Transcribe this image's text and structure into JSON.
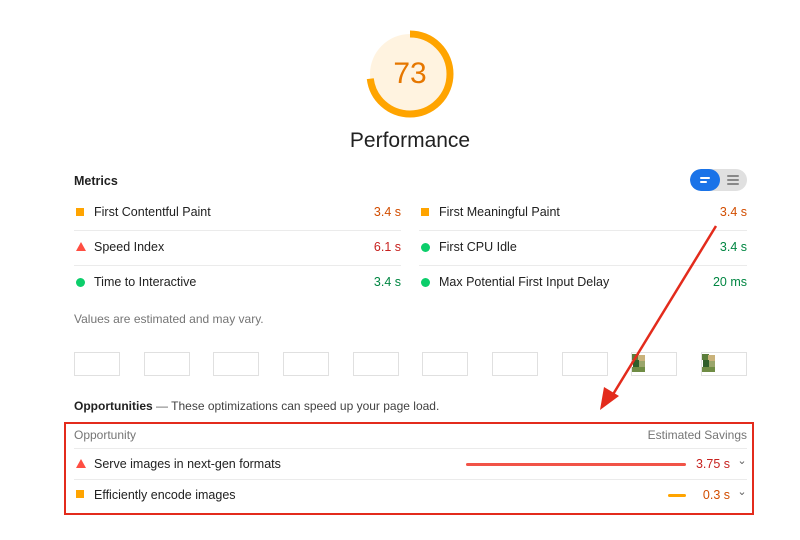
{
  "score": {
    "value": "73",
    "fraction": 0.73,
    "color": "#ffa400"
  },
  "category_title": "Performance",
  "metrics": {
    "title": "Metrics",
    "toggle": {
      "selected": "list-view",
      "options": [
        "list-view",
        "text-view"
      ]
    },
    "items": [
      {
        "label": "First Contentful Paint",
        "value": "3.4 s",
        "status": "average"
      },
      {
        "label": "First Meaningful Paint",
        "value": "3.4 s",
        "status": "average"
      },
      {
        "label": "Speed Index",
        "value": "6.1 s",
        "status": "fail"
      },
      {
        "label": "First CPU Idle",
        "value": "3.4 s",
        "status": "pass"
      },
      {
        "label": "Time to Interactive",
        "value": "3.4 s",
        "status": "pass"
      },
      {
        "label": "Max Potential First Input Delay",
        "value": "20 ms",
        "status": "pass"
      }
    ],
    "note": "Values are estimated and may vary."
  },
  "filmstrip": {
    "frames": 10,
    "frames_with_image": [
      9,
      10
    ]
  },
  "opportunities": {
    "title": "Opportunities",
    "separator": "—",
    "description": "These optimizations can speed up your page load.",
    "header_left": "Opportunity",
    "header_right": "Estimated Savings",
    "items": [
      {
        "label": "Serve images in next-gen formats",
        "savings": "3.75 s",
        "status": "fail",
        "bar_fraction": 1.0
      },
      {
        "label": "Efficiently encode images",
        "savings": "0.3 s",
        "status": "average",
        "bar_fraction": 0.08
      }
    ]
  },
  "colors": {
    "pass": "#0cce6b",
    "average": "#ffa400",
    "fail": "#ff4e42",
    "highlight": "#e32b1c",
    "toggle_active": "#1a73e8"
  }
}
